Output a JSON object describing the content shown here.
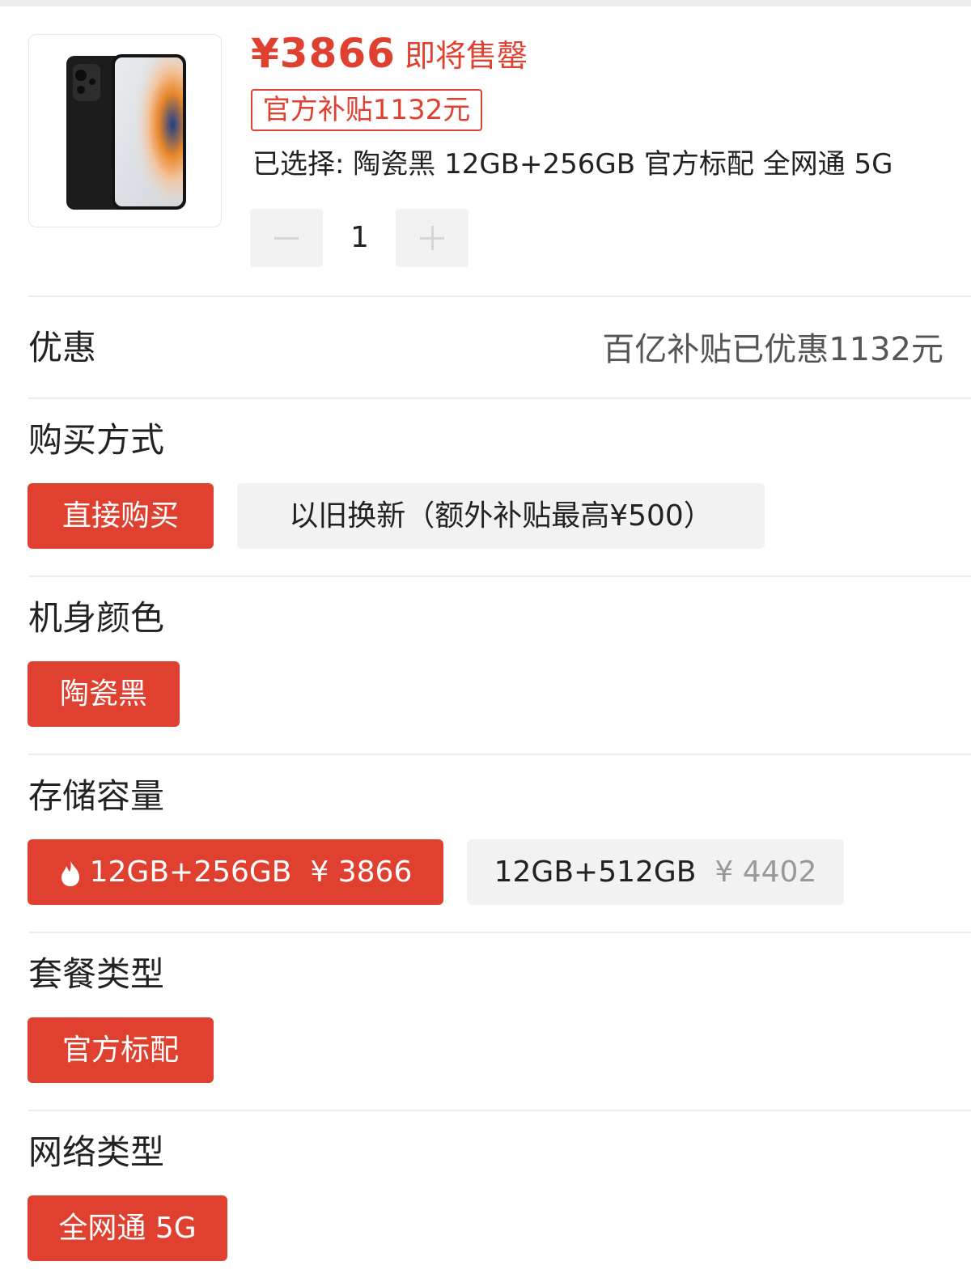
{
  "product": {
    "price": "¥3866",
    "sellout": "即将售罄",
    "subsidy_tag": "官方补贴1132元",
    "selected_info": "已选择: 陶瓷黑 12GB+256GB 官方标配 全网通 5G",
    "quantity": "1"
  },
  "promotion": {
    "title": "优惠",
    "value": "百亿补贴已优惠1132元"
  },
  "purchase_method": {
    "title": "购买方式",
    "options": [
      "直接购买",
      "以旧换新（额外补贴最高¥500）"
    ]
  },
  "color": {
    "title": "机身颜色",
    "options": [
      "陶瓷黑"
    ]
  },
  "storage": {
    "title": "存储容量",
    "options": [
      {
        "label": "12GB+256GB",
        "price": "¥ 3866",
        "icon": "flame-icon"
      },
      {
        "label": "12GB+512GB",
        "price": "¥ 4402"
      }
    ]
  },
  "package": {
    "title": "套餐类型",
    "options": [
      "官方标配"
    ]
  },
  "network": {
    "title": "网络类型",
    "options": [
      "全网通 5G"
    ]
  },
  "colors": {
    "accent": "#e0402f",
    "chip_inactive": "#f2f2f2",
    "divider": "#ededed"
  }
}
